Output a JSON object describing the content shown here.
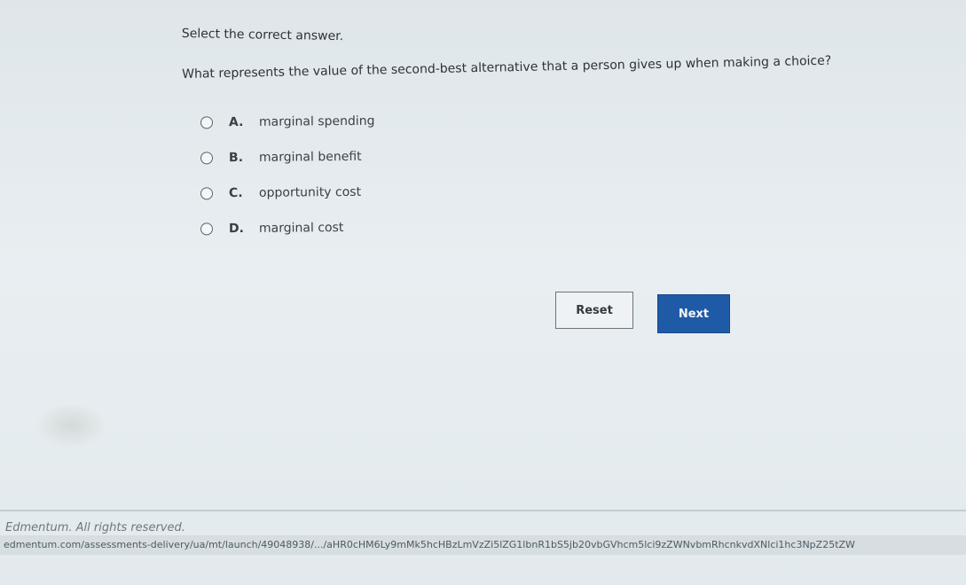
{
  "instruction": "Select the correct answer.",
  "question": "What represents the value of the second-best alternative that a person gives up when making a choice?",
  "options": [
    {
      "letter": "A.",
      "text": "marginal spending"
    },
    {
      "letter": "B.",
      "text": "marginal benefit"
    },
    {
      "letter": "C.",
      "text": "opportunity cost"
    },
    {
      "letter": "D.",
      "text": "marginal cost"
    }
  ],
  "buttons": {
    "reset_label": "Reset",
    "next_label": "Next"
  },
  "footer": {
    "copyright": "Edmentum. All rights reserved.",
    "url": "edmentum.com/assessments-delivery/ua/mt/launch/49048938/.../aHR0cHM6Ly9mMk5hcHBzLmVzZi5lZG1lbnR1bS5jb20vbGVhcm5lci9zZWNvbmRhcnkvdXNlci1hc3NpZ25tZW"
  }
}
